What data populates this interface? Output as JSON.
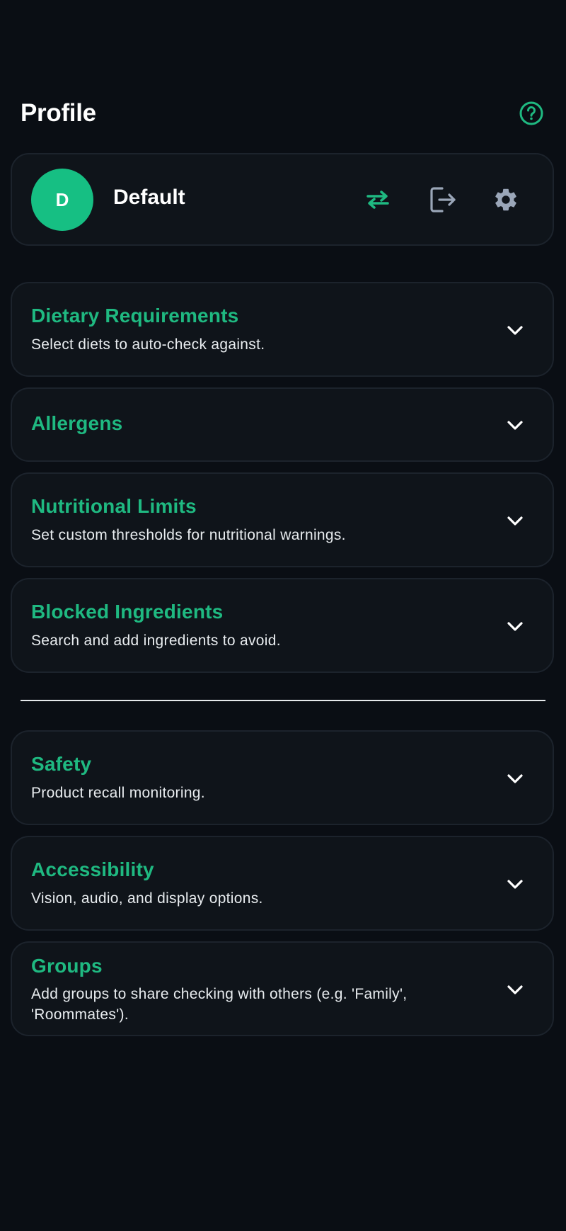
{
  "header": {
    "title": "Profile",
    "help_icon": "help-circle-icon"
  },
  "profile": {
    "avatar_initial": "D",
    "name": "Default",
    "avatar_color": "#16bf83",
    "actions": [
      "switch-profile-icon",
      "logout-icon",
      "settings-gear-icon"
    ]
  },
  "sections": [
    {
      "title": "Dietary Requirements",
      "subtitle": "Select diets to auto-check against."
    },
    {
      "title": "Allergens",
      "subtitle": ""
    },
    {
      "title": "Nutritional Limits",
      "subtitle": "Set custom thresholds for nutritional warnings."
    },
    {
      "title": "Blocked Ingredients",
      "subtitle": "Search and add ingredients to avoid."
    },
    {
      "title": "Safety",
      "subtitle": "Product recall monitoring."
    },
    {
      "title": "Accessibility",
      "subtitle": "Vision, audio, and display options."
    },
    {
      "title": "Groups",
      "subtitle": "Add groups to share checking with others (e.g. 'Family', 'Roommates')."
    }
  ],
  "colors": {
    "accent": "#1fb981",
    "background": "#0a0e14",
    "card": "#0f141a",
    "icon_muted": "#9aa6b8"
  }
}
